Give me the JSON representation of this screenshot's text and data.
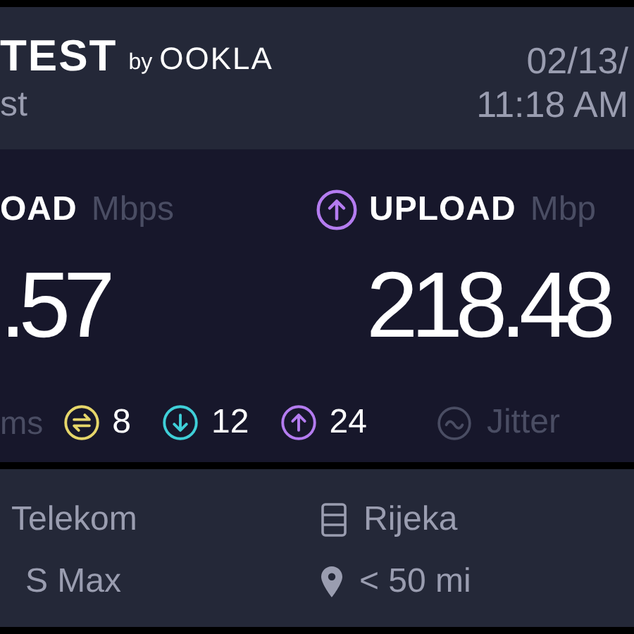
{
  "header": {
    "brand": "TEST",
    "brand_suffix": "by",
    "brand_company": "OOKLA",
    "subtitle": "st",
    "date": "02/13/",
    "time": "11:18 AM"
  },
  "results": [
    {
      "kind": "download",
      "label": "OAD",
      "unit": "Mbps",
      "value": ".57"
    },
    {
      "kind": "upload",
      "label": "UPLOAD",
      "unit": "Mbp",
      "value": "218.48"
    }
  ],
  "ping": {
    "unit": "ms",
    "items": [
      {
        "kind": "idle",
        "value": "8",
        "color": "#e6d66a"
      },
      {
        "kind": "download",
        "value": "12",
        "color": "#3fcfd8"
      },
      {
        "kind": "upload",
        "value": "24",
        "color": "#b47cf0"
      }
    ]
  },
  "jitter": {
    "label": "Jitter"
  },
  "info": [
    {
      "kind": "provider",
      "text": "Telekom"
    },
    {
      "kind": "server",
      "text": "Rijeka"
    },
    {
      "kind": "device",
      "text": "S Max"
    },
    {
      "kind": "distance",
      "text": "< 50 mi"
    }
  ]
}
